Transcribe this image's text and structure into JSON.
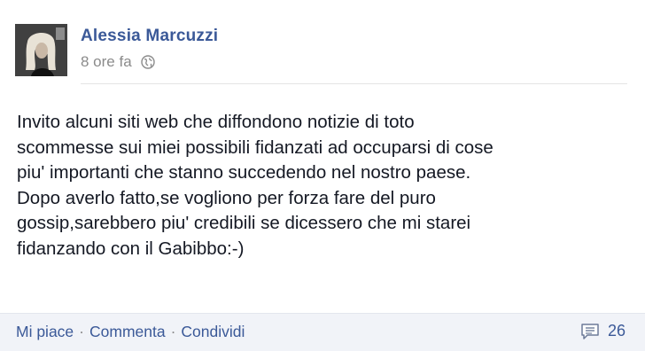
{
  "post": {
    "author": "Alessia Marcuzzi",
    "timestamp": "8 ore fa",
    "audience_icon": "globe-icon",
    "body_lines": [
      "Invito alcuni siti web che diffondono notizie di toto",
      "scommesse sui miei possibili fidanzati ad occuparsi di cose",
      "piu' importanti che stanno succedendo nel nostro paese.",
      "Dopo averlo fatto,se vogliono per forza fare del puro",
      "gossip,sarebbero piu' credibili se dicessero che mi starei",
      "fidanzando con il Gabibbo:-)"
    ]
  },
  "actions": {
    "like": "Mi piace",
    "comment": "Commenta",
    "share": "Condividi",
    "separator": "·"
  },
  "comments": {
    "icon": "comment-icon",
    "count": "26"
  },
  "colors": {
    "link": "#3b5998",
    "meta": "#8b8b8b",
    "footer_bg": "#f1f3f8"
  }
}
